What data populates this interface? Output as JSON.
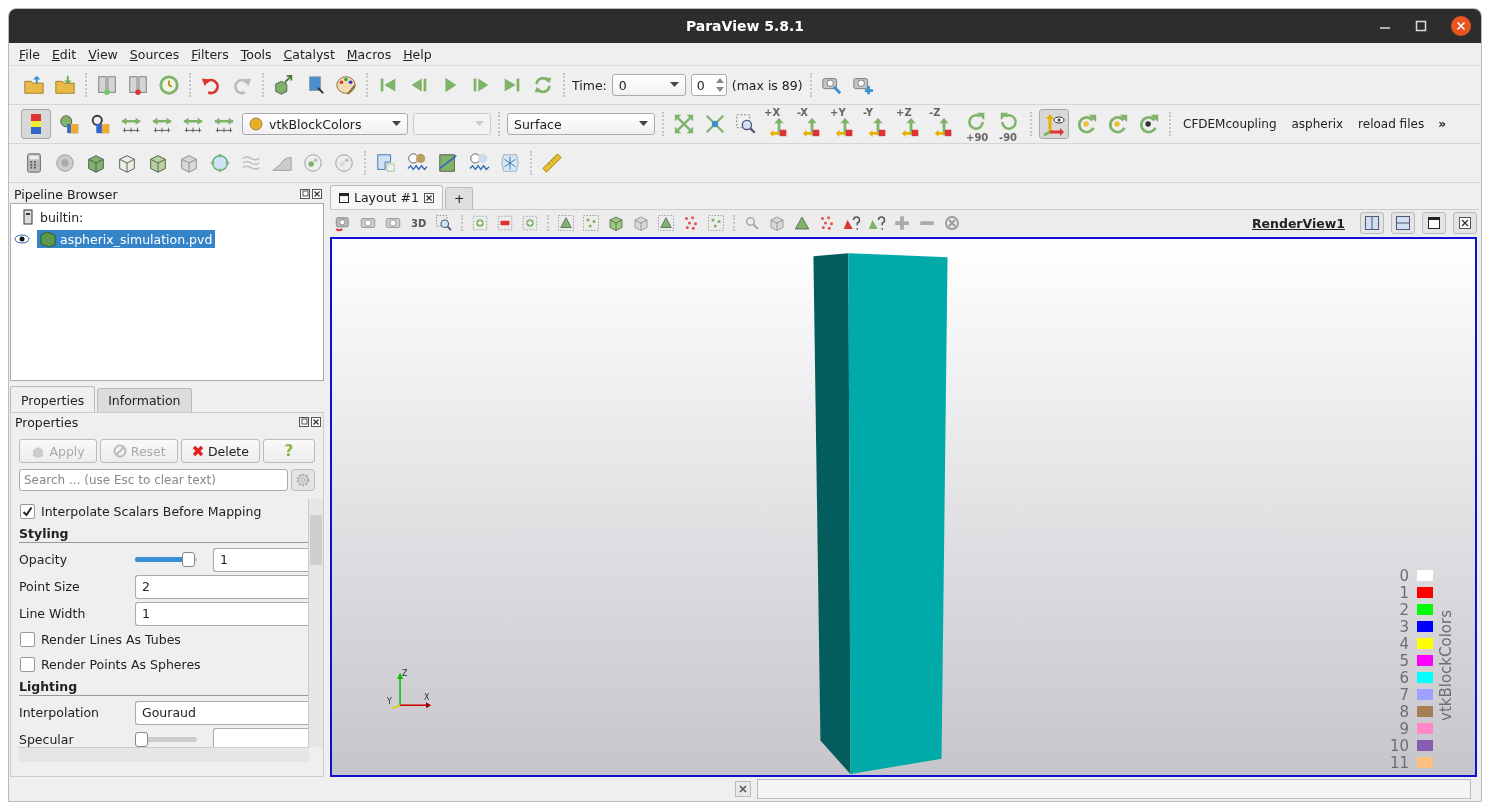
{
  "window": {
    "title": "ParaView 5.8.1"
  },
  "menu": [
    {
      "label": "File"
    },
    {
      "label": "Edit"
    },
    {
      "label": "View"
    },
    {
      "label": "Sources"
    },
    {
      "label": "Filters"
    },
    {
      "label": "Tools"
    },
    {
      "label": "Catalyst"
    },
    {
      "label": "Macros"
    },
    {
      "label": "Help"
    }
  ],
  "time_toolbar": {
    "label": "Time:",
    "time_value": "0",
    "step_value": "0",
    "max_note": "(max is 89)"
  },
  "coloring_toolbar": {
    "array": "vtkBlockColors",
    "component_disabled": true,
    "representation": "Surface"
  },
  "view_buttons": [
    {
      "label": "+X"
    },
    {
      "label": "-X"
    },
    {
      "label": "+Y"
    },
    {
      "label": "-Y"
    },
    {
      "label": "+Z"
    },
    {
      "label": "-Z"
    }
  ],
  "rotate_buttons": [
    {
      "label": "+90"
    },
    {
      "label": "-90"
    }
  ],
  "macros": [
    {
      "label": "CFDEMcoupling"
    },
    {
      "label": "aspherix"
    },
    {
      "label": "reload files"
    }
  ],
  "overflow": "»",
  "pipeline_browser": {
    "title": "Pipeline Browser",
    "items": [
      {
        "label": "builtin:",
        "kind": "server",
        "selected": false,
        "children": [
          {
            "label": "aspherix_simulation.pvd",
            "kind": "source",
            "selected": true,
            "visible": true
          }
        ]
      }
    ]
  },
  "panel_tabs": [
    {
      "label": "Properties",
      "selected": true
    },
    {
      "label": "Information",
      "selected": false
    }
  ],
  "properties": {
    "title": "Properties",
    "buttons": [
      {
        "label": "Apply",
        "kind": "apply",
        "disabled": true
      },
      {
        "label": "Reset",
        "kind": "reset",
        "disabled": true
      },
      {
        "label": "Delete",
        "kind": "delete",
        "disabled": false
      },
      {
        "label": "?",
        "kind": "help",
        "disabled": false
      }
    ],
    "search": {
      "placeholder": "Search ... (use Esc to clear text)"
    },
    "rows": [
      {
        "kind": "checkbox",
        "label": "Interpolate Scalars Before Mapping",
        "checked": true
      },
      {
        "kind": "section",
        "label": "Styling"
      },
      {
        "kind": "slider",
        "label": "Opacity",
        "level": 0.95,
        "value": "1"
      },
      {
        "kind": "field",
        "label": "Point Size",
        "value": "2"
      },
      {
        "kind": "field",
        "label": "Line Width",
        "value": "1"
      },
      {
        "kind": "checkbox",
        "label": "Render Lines As Tubes",
        "checked": false
      },
      {
        "kind": "checkbox",
        "label": "Render Points As Spheres",
        "checked": false
      },
      {
        "kind": "section",
        "label": "Lighting"
      },
      {
        "kind": "dropdown",
        "label": "Interpolation",
        "value": "Gouraud"
      },
      {
        "kind": "slider",
        "label": "Specular",
        "level": 0
      }
    ]
  },
  "layout_tabs": [
    {
      "label": "Layout #1",
      "kind": "layout",
      "selected": true
    },
    {
      "label": "+",
      "kind": "new",
      "selected": false
    }
  ],
  "render_toolbar": {
    "mode_label": "3D",
    "view_name": "RenderView1"
  },
  "axes": {
    "x": "X",
    "y": "Y",
    "z": "Z"
  },
  "legend": {
    "title": "vtkBlockColors",
    "entries": [
      {
        "label": "0",
        "color": "#ffffff"
      },
      {
        "label": "1",
        "color": "#ff0000"
      },
      {
        "label": "2",
        "color": "#00ff00"
      },
      {
        "label": "3",
        "color": "#0000ff"
      },
      {
        "label": "4",
        "color": "#ffff00"
      },
      {
        "label": "5",
        "color": "#ff00ff"
      },
      {
        "label": "6",
        "color": "#00ffff"
      },
      {
        "label": "7",
        "color": "#a0a0ff"
      },
      {
        "label": "8",
        "color": "#a67d57"
      },
      {
        "label": "9",
        "color": "#ff88c8"
      },
      {
        "label": "10",
        "color": "#8a5cb0"
      },
      {
        "label": "11",
        "color": "#ffbf80"
      }
    ]
  }
}
